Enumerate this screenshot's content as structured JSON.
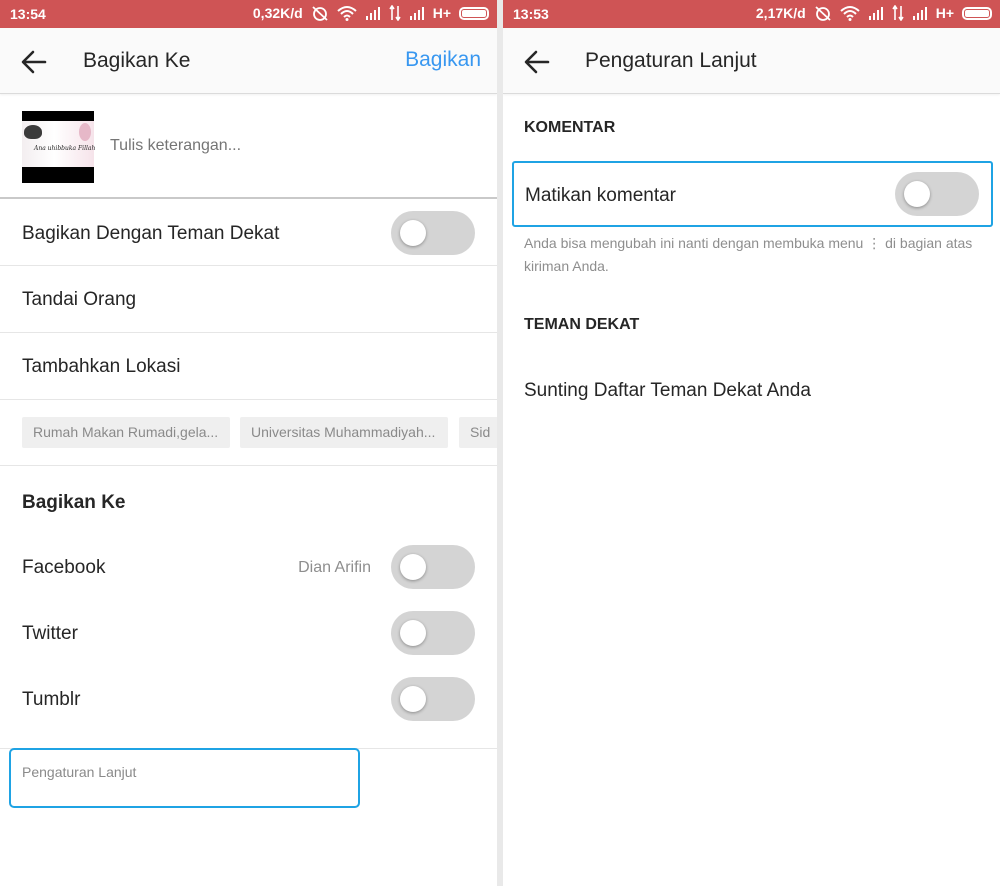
{
  "left": {
    "status": {
      "time": "13:54",
      "speed": "0,32K/d",
      "network": "H+"
    },
    "header": {
      "title": "Bagikan Ke",
      "action": "Bagikan"
    },
    "caption": {
      "placeholder": "Tulis keterangan...",
      "thumbnail_text": "Ana uhibbuka Fillah"
    },
    "close_friends": {
      "label": "Bagikan Dengan Teman Dekat",
      "on": false
    },
    "tag_people": "Tandai Orang",
    "add_location": "Tambahkan Lokasi",
    "location_suggestions": [
      "Rumah Makan Rumadi,gela...",
      "Universitas Muhammadiyah...",
      "Sid"
    ],
    "share_section": {
      "title": "Bagikan Ke",
      "items": [
        {
          "label": "Facebook",
          "account": "Dian Arifin",
          "on": false
        },
        {
          "label": "Twitter",
          "account": "",
          "on": false
        },
        {
          "label": "Tumblr",
          "account": "",
          "on": false
        }
      ]
    },
    "advanced_settings": "Pengaturan Lanjut"
  },
  "right": {
    "status": {
      "time": "13:53",
      "speed": "2,17K/d",
      "network": "H+"
    },
    "header": {
      "title": "Pengaturan Lanjut"
    },
    "comments": {
      "heading": "KOMENTAR",
      "toggle_label": "Matikan komentar",
      "on": false,
      "help_text": "Anda bisa mengubah ini nanti dengan membuka menu ⋮ di bagian atas kiriman Anda."
    },
    "close_friends": {
      "heading": "TEMAN DEKAT",
      "link": "Sunting Daftar Teman Dekat Anda"
    }
  },
  "colors": {
    "status_bar": "#cf5455",
    "accent_blue": "#3897f0",
    "highlight_border": "#1fa3e4",
    "toggle_off": "#d4d4d4"
  },
  "icons": [
    "back-arrow-icon",
    "alarm-off-icon",
    "wifi-icon",
    "signal-icon",
    "data-transfer-icon",
    "battery-icon"
  ]
}
